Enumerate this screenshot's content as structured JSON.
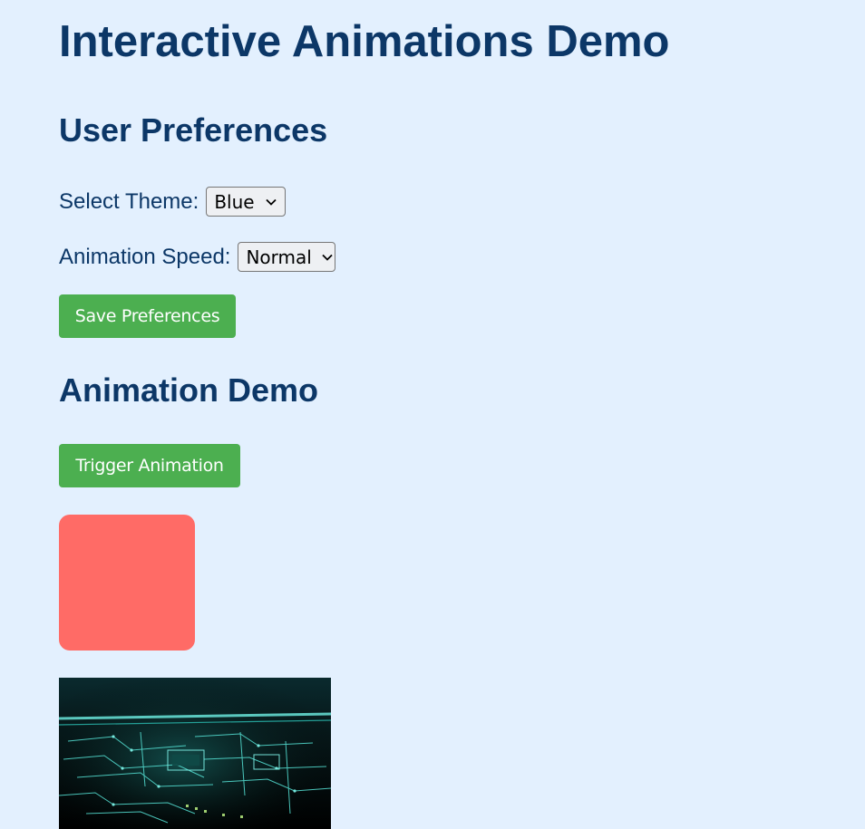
{
  "page": {
    "title": "Interactive Animations Demo"
  },
  "preferences": {
    "heading": "User Preferences",
    "theme_label": "Select Theme:",
    "theme_value": "Blue",
    "speed_label": "Animation Speed:",
    "speed_value": "Normal",
    "save_label": "Save Preferences"
  },
  "animation": {
    "heading": "Animation Demo",
    "trigger_label": "Trigger Animation",
    "box_color": "#ff6b66",
    "image_icon": "circuit-board-image"
  },
  "colors": {
    "background": "#e3f0fe",
    "heading": "#0c3767",
    "button": "#4caf50"
  }
}
